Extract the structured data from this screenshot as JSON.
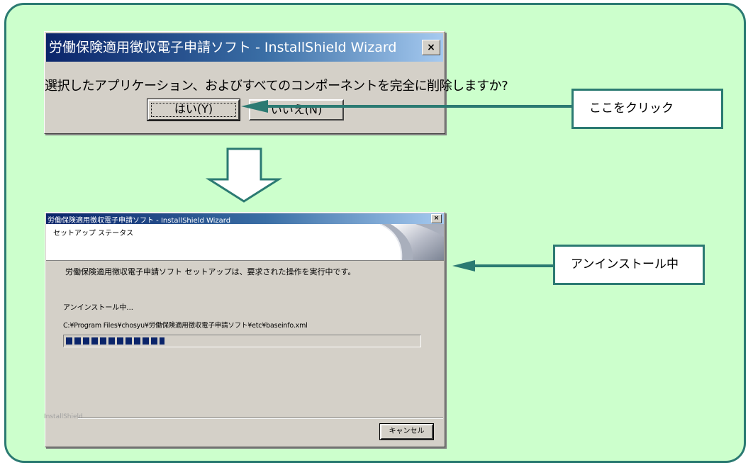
{
  "confirm_dialog": {
    "title": "労働保険適用徴収電子申請ソフト - InstallShield Wizard",
    "close_glyph": "×",
    "message": "選択したアプリケーション、およびすべてのコンポーネントを完全に削除しますか?",
    "yes_label": "はい(Y)",
    "no_label": "いいえ(N)"
  },
  "callouts": {
    "click_here": "ここをクリック",
    "uninstalling": "アンインストール中"
  },
  "progress_dialog": {
    "title": "労働保険適用徴収電子申請ソフト - InstallShield Wizard",
    "close_glyph": "×",
    "header_title": "セットアップ ステータス",
    "status_message": "労働保険適用徴収電子申請ソフト セットアップは、要求された操作を実行中です。",
    "operation_label": "アンインストール中...",
    "current_file": "C:¥Program Files¥chosyu¥労働保険適用徴収電子申請ソフト¥etc¥baseinfo.xml",
    "progress": 0.28,
    "brand": "InstallShield",
    "cancel_label": "キャンセル"
  },
  "colors": {
    "panel_bg": "#ccffcc",
    "panel_border": "#2b7a72",
    "arrow": "#2b7a72",
    "titlebar_start": "#0a246a",
    "titlebar_end": "#a6caf0",
    "progress_block": "#0a246a"
  }
}
